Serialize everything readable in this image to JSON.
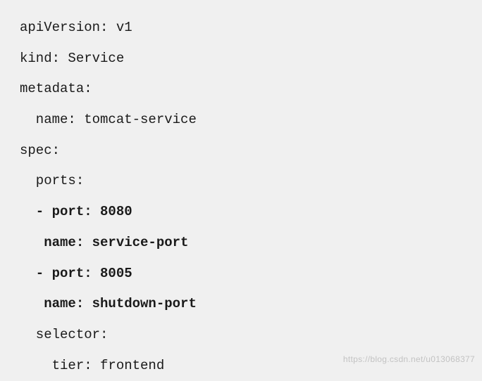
{
  "lines": [
    {
      "text": "apiVersion: v1",
      "indent": 0,
      "bold": false
    },
    {
      "text": "kind: Service",
      "indent": 0,
      "bold": false
    },
    {
      "text": "metadata:",
      "indent": 0,
      "bold": false
    },
    {
      "text": "name: tomcat-service",
      "indent": 1,
      "bold": false
    },
    {
      "text": "spec:",
      "indent": 0,
      "bold": false
    },
    {
      "text": "ports:",
      "indent": 1,
      "bold": false
    },
    {
      "text": "- port: 8080",
      "indent": 1,
      "bold": true
    },
    {
      "text": " name: service-port",
      "indent": 1,
      "bold": true
    },
    {
      "text": "- port: 8005",
      "indent": 1,
      "bold": true
    },
    {
      "text": " name: shutdown-port",
      "indent": 1,
      "bold": true
    },
    {
      "text": "selector:",
      "indent": 1,
      "bold": false
    },
    {
      "text": "tier: frontend",
      "indent": 2,
      "bold": false
    }
  ],
  "watermark": "https://blog.csdn.net/u013068377"
}
